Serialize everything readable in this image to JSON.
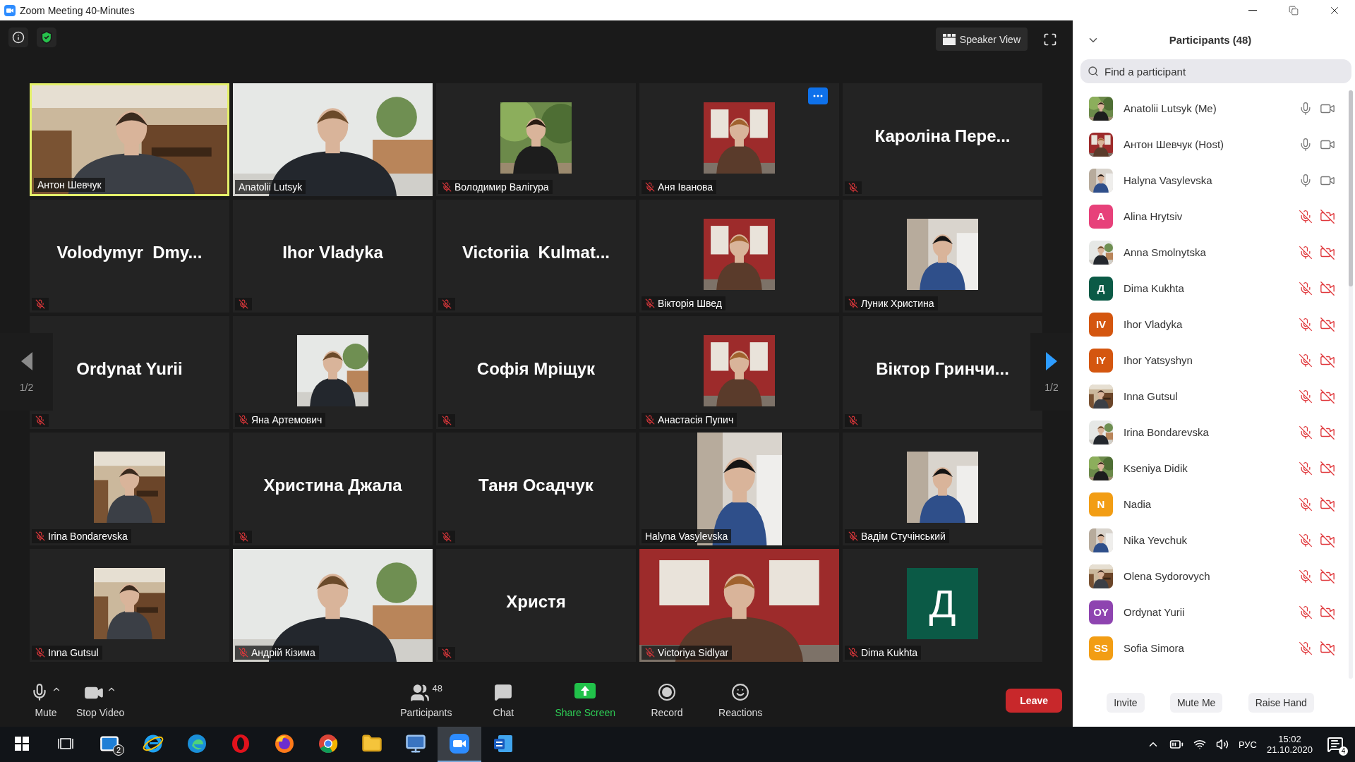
{
  "window": {
    "title": "Zoom Meeting 40-Minutes"
  },
  "top_bar": {
    "view_button": "Speaker View"
  },
  "tiles": [
    {
      "kind": "video",
      "name": "Антон Шевчук",
      "muted": false,
      "active": true
    },
    {
      "kind": "video",
      "name": "Anatolii Lutsyk",
      "muted": false,
      "active": false
    },
    {
      "name": "Володимир Валігура",
      "muted": true,
      "active": false
    },
    {
      "name": "Аня Іванова",
      "muted": true,
      "active": false,
      "more_button": true
    },
    {
      "kind": "name",
      "name": "Кароліна Пере...",
      "muted": true,
      "active": false
    },
    {
      "kind": "name",
      "name": "Volodymyr  Dmy...",
      "muted": true,
      "active": false
    },
    {
      "kind": "name",
      "name": "Ihor Vladyka",
      "muted": true,
      "active": false
    },
    {
      "kind": "name",
      "name": "Victoriia  Kulmat...",
      "muted": true,
      "active": false
    },
    {
      "name": "Вікторія Швед",
      "muted": true,
      "active": false
    },
    {
      "name": "Луник Христина",
      "muted": true,
      "active": false
    },
    {
      "kind": "name",
      "name": "Ordynat Yurii",
      "muted": true,
      "active": false
    },
    {
      "name": "Яна Артемович",
      "muted": true,
      "active": false
    },
    {
      "kind": "name",
      "name": "Софія Мріщук",
      "muted": true,
      "active": false
    },
    {
      "name": "Анастасія Пупич",
      "muted": true,
      "active": false
    },
    {
      "kind": "name",
      "name": "Віктор Гринчи...",
      "muted": true,
      "active": false
    },
    {
      "name": "Irina Bondarevska",
      "muted": true,
      "active": false
    },
    {
      "kind": "name",
      "name": "Христина Джала",
      "muted": true,
      "active": false
    },
    {
      "kind": "name",
      "name": "Таня Осадчук",
      "muted": true,
      "active": false
    },
    {
      "kind": "narrow_video",
      "name": "Halyna Vasylevska",
      "muted": false,
      "active": false
    },
    {
      "name": "Вадім Стучінський",
      "muted": true,
      "active": false
    },
    {
      "name": "Inna Gutsul",
      "muted": true,
      "active": false
    },
    {
      "kind": "video",
      "name": "Андрій Кізима",
      "muted": true,
      "active": false
    },
    {
      "kind": "name",
      "name": "Христя",
      "muted": true,
      "active": false
    },
    {
      "kind": "video",
      "name": "Victoriya Sidlyar",
      "muted": true,
      "active": false
    },
    {
      "kind": "initial",
      "initial": "Д",
      "color": "#0b5a46",
      "name": "Dima Kukhta",
      "muted": true,
      "active": false
    }
  ],
  "pager": {
    "left": {
      "label": "1/2",
      "enabled": false
    },
    "right": {
      "label": "1/2",
      "enabled": true
    }
  },
  "toolbar": [
    {
      "kind": "mute",
      "label": "Mute",
      "caret": true
    },
    {
      "kind": "stop_video",
      "label": "Stop Video",
      "caret": true
    },
    {
      "kind": "participants",
      "label": "Participants",
      "count": "48"
    },
    {
      "kind": "chat",
      "label": "Chat"
    },
    {
      "kind": "share_screen",
      "label": "Share Screen"
    },
    {
      "kind": "record",
      "label": "Record"
    },
    {
      "kind": "reactions",
      "label": "Reactions"
    }
  ],
  "leave_button": "Leave",
  "participants": {
    "title": "Participants (48)",
    "search": {
      "placeholder": "Find a participant"
    },
    "items": [
      {
        "name": "Anatolii Lutsyk (Me)",
        "audio": true,
        "video": true
      },
      {
        "name": "Антон Шевчук (Host)",
        "audio": true,
        "video": true
      },
      {
        "name": "Halyna Vasylevska",
        "audio": true,
        "video": true
      },
      {
        "name": "Alina Hrytsiv",
        "kind": "initials",
        "initials": "A",
        "color": "#e7417a",
        "audio": false,
        "video": false
      },
      {
        "name": "Anna Smolnytska",
        "audio": false,
        "video": false
      },
      {
        "name": "Dima Kukhta",
        "kind": "initials",
        "initials": "Д",
        "color": "#0b5a46",
        "audio": false,
        "video": false
      },
      {
        "name": "Ihor Vladyka",
        "kind": "initials",
        "initials": "IV",
        "color": "#d4560f",
        "audio": false,
        "video": false
      },
      {
        "name": "Ihor Yatsyshyn",
        "kind": "initials",
        "initials": "IY",
        "color": "#d4560f",
        "audio": false,
        "video": false
      },
      {
        "name": "Inna Gutsul",
        "audio": false,
        "video": false
      },
      {
        "name": "Irina Bondarevska",
        "audio": false,
        "video": false
      },
      {
        "name": "Kseniya Didik",
        "audio": false,
        "video": false
      },
      {
        "name": "Nadia",
        "kind": "initials",
        "initials": "N",
        "color": "#f29d14",
        "audio": false,
        "video": false
      },
      {
        "name": "Nika Yevchuk",
        "audio": false,
        "video": false
      },
      {
        "name": "Olena Sydorovych",
        "audio": false,
        "video": false
      },
      {
        "name": "Ordynat Yurii",
        "kind": "initials",
        "initials": "OY",
        "color": "#8e44b0",
        "audio": false,
        "video": false
      },
      {
        "name": "Sofia Simora",
        "kind": "initials",
        "initials": "SS",
        "color": "#f29d14",
        "audio": false,
        "video": false
      }
    ],
    "buttons": [
      "Invite",
      "Mute Me",
      "Raise Hand"
    ]
  },
  "taskbar": {
    "apps": [
      {
        "kind": "start",
        "active": false
      },
      {
        "kind": "task_view",
        "active": false
      },
      {
        "kind": "mail",
        "active": false,
        "badge": "2"
      },
      {
        "kind": "ie",
        "active": false
      },
      {
        "kind": "edge",
        "active": false
      },
      {
        "kind": "opera",
        "active": false
      },
      {
        "kind": "firefox",
        "active": false
      },
      {
        "kind": "chrome",
        "active": false
      },
      {
        "kind": "explorer",
        "active": false
      },
      {
        "kind": "network",
        "active": false
      },
      {
        "kind": "zoom",
        "active": true
      },
      {
        "kind": "word",
        "active": false
      }
    ],
    "language": "РУС",
    "time": "15:02",
    "date": "21.10.2020",
    "notifications": "4"
  }
}
